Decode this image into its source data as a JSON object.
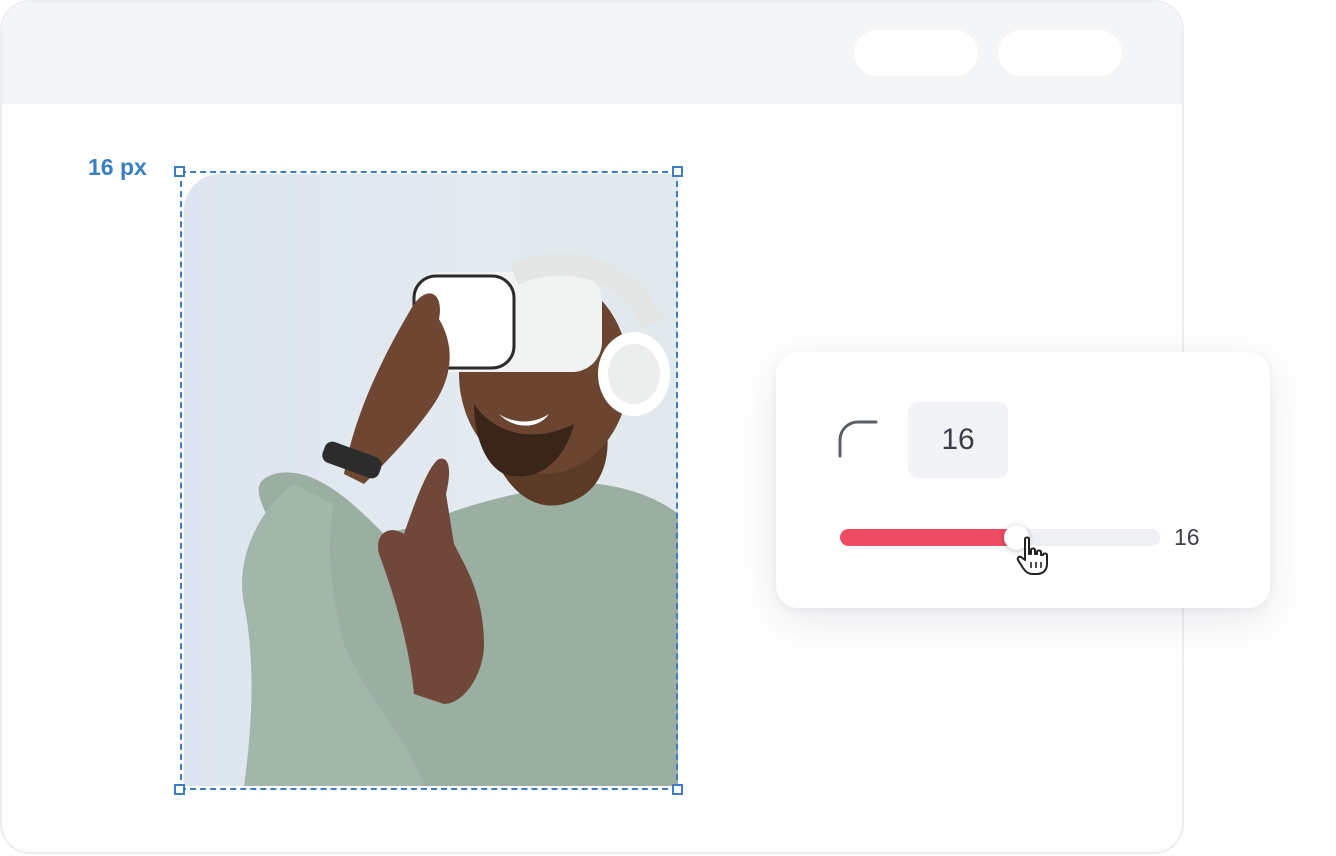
{
  "canvas": {
    "size_label": "16 px",
    "image": {
      "description_icon": "photo-icon"
    },
    "selection_color": "#3d7cc6"
  },
  "radius_panel": {
    "icon": "corner-radius-icon",
    "value": "16",
    "slider": {
      "value_label": "16",
      "level_fraction": 0.55,
      "fill_color": "#ee4c63"
    },
    "cursor_icon": "hand-pointer-icon"
  }
}
